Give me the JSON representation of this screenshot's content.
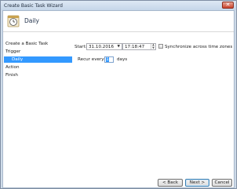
{
  "window": {
    "title": "Create Basic Task Wizard",
    "close_glyph": "✕"
  },
  "header": {
    "page_title": "Daily",
    "icon": "task-scheduler-icon"
  },
  "sidebar": {
    "items": [
      {
        "label": "Create a Basic Task"
      },
      {
        "label": "Trigger"
      },
      {
        "label": "Daily"
      },
      {
        "label": "Action"
      },
      {
        "label": "Finish"
      }
    ]
  },
  "schedule": {
    "start_label": "Start:",
    "date_value": "31.10.2016",
    "time_value": "17:18:47",
    "sync_label": "Synchronize across time zones",
    "recur_label": "Recur every:",
    "recur_value": "1",
    "recur_unit": "days"
  },
  "buttons": {
    "back": "< Back",
    "next": "Next >",
    "cancel": "Cancel"
  },
  "colors": {
    "selection": "#3399ff",
    "frame": "#cfdcea"
  }
}
